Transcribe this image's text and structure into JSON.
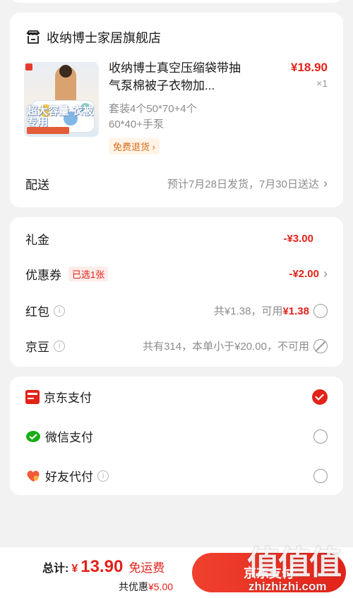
{
  "store": {
    "name": "收纳博士家居旗舰店",
    "icon": "store-icon",
    "product": {
      "title": "收纳博士真空压缩袋带抽气泵棉被子衣物加...",
      "spec": "套装4个50*70+4个60*40+手泵",
      "price": "¥18.90",
      "qty": "×1",
      "badge": "免费退货",
      "image_text": "超大容量 衣被专用"
    },
    "delivery": {
      "label": "配送",
      "value": "预计7月28日发货，7月30日送达"
    }
  },
  "discounts": {
    "gift": {
      "label": "礼金",
      "value": "-¥3.00"
    },
    "coupon": {
      "label": "优惠券",
      "badge": "已选1张",
      "value": "-¥2.00"
    },
    "redpack": {
      "label": "红包",
      "value_prefix": "共¥1.38，可用",
      "value_red": "¥1.38"
    },
    "jingdou": {
      "label": "京豆",
      "value": "共有314，本单小于¥20.00，不可用"
    }
  },
  "payment": {
    "options": [
      {
        "label": "京东支付",
        "icon": "jd-pay-icon",
        "selected": true
      },
      {
        "label": "微信支付",
        "icon": "wechat-pay-icon",
        "selected": false
      },
      {
        "label": "好友代付",
        "icon": "friend-pay-icon",
        "selected": false
      }
    ]
  },
  "footer": {
    "total_label": "总计:",
    "currency": "¥",
    "total": "13.90",
    "free_shipping": "免运费",
    "saved_label": "共优惠",
    "saved_amount": "¥5.00",
    "pay_button": "京东支付"
  },
  "watermark": {
    "text": "值值值",
    "url": "zhizhizhi.com"
  },
  "colors": {
    "accent": "#e2231a",
    "background": "#f2f2f2"
  }
}
